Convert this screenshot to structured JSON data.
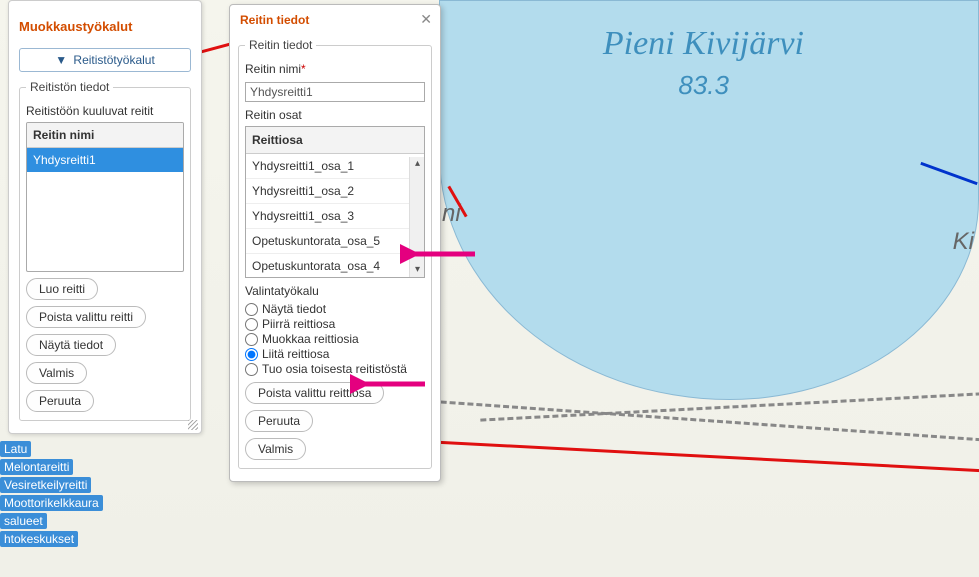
{
  "map": {
    "lake_name": "Pieni Kivijärvi",
    "lake_elev": "83.3",
    "area_label_right": "Ki",
    "truncated_label": "ni"
  },
  "sidebar": {
    "title": "Muokkaustyökalut",
    "tools_toggle": "Reitistötyökalut",
    "fieldset_legend": "Reitistön tiedot",
    "routes_label": "Reitistöön kuuluvat reitit",
    "list_header": "Reitin nimi",
    "routes": [
      "Yhdysreitti1"
    ],
    "buttons": {
      "create": "Luo reitti",
      "delete": "Poista valittu reitti",
      "show": "Näytä tiedot",
      "done": "Valmis",
      "cancel": "Peruuta"
    }
  },
  "legend": {
    "items": [
      "Latu",
      "Melontareitti",
      "Vesiretkeilyreitti",
      "Moottorikelkkaura",
      "salueet",
      "htokeskukset"
    ]
  },
  "dialog": {
    "title": "Reitin tiedot",
    "fieldset_legend": "Reitin tiedot",
    "name_label": "Reitin nimi",
    "name_value": "Yhdysreitti1",
    "parts_label": "Reitin osat",
    "parts_header": "Reittiosa",
    "parts": [
      "Yhdysreitti1_osa_1",
      "Yhdysreitti1_osa_2",
      "Yhdysreitti1_osa_3",
      "Opetuskuntorata_osa_5",
      "Opetuskuntorata_osa_4"
    ],
    "selection_label": "Valintatyökalu",
    "radios": {
      "show": "Näytä tiedot",
      "draw": "Piirrä reittiosa",
      "edit": "Muokkaa reittiosia",
      "attach": "Liitä reittiosa",
      "import": "Tuo osia toisesta reitistöstä"
    },
    "selected_radio": "attach",
    "buttons": {
      "delete_part": "Poista valittu reittiosa",
      "cancel": "Peruuta",
      "done": "Valmis"
    }
  }
}
